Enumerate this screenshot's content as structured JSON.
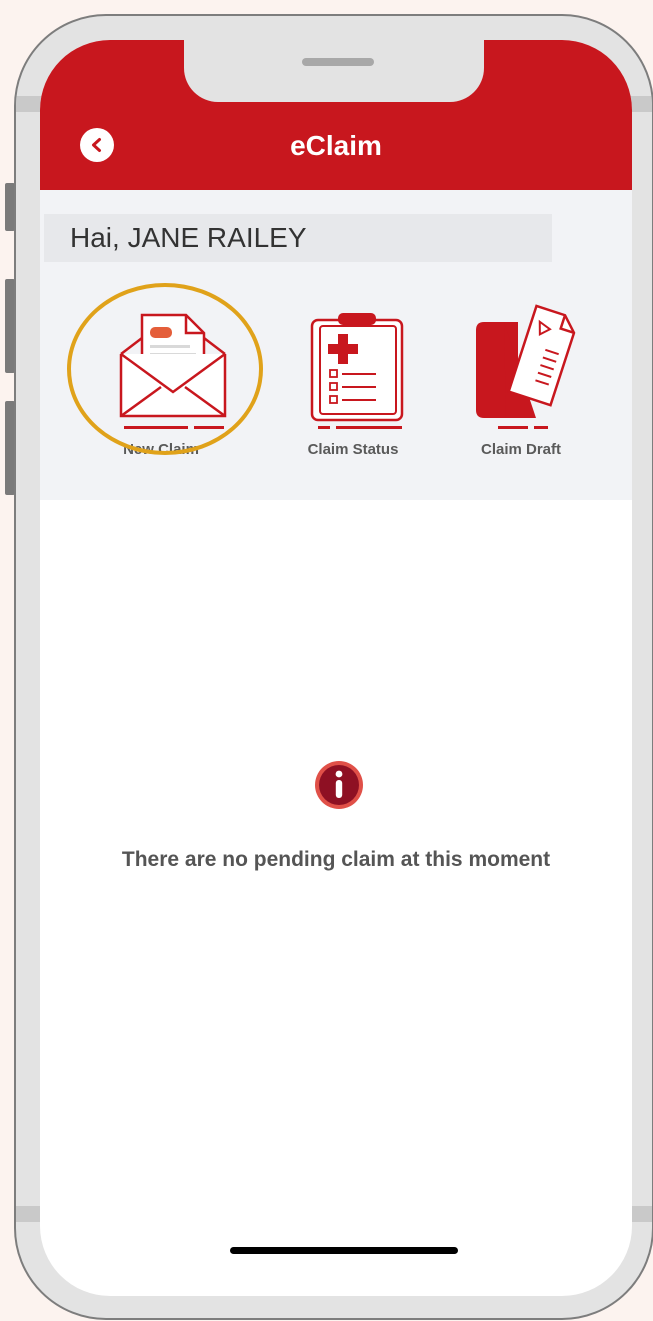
{
  "header": {
    "title": "eClaim",
    "back_icon": "chevron-left-icon",
    "color": "#c8171e"
  },
  "greeting": {
    "text": "Hai, JANE RAILEY"
  },
  "menu": [
    {
      "label": "New Claim",
      "icon": "envelope-document-icon",
      "highlighted": true
    },
    {
      "label": "Claim Status",
      "icon": "clipboard-medical-icon",
      "highlighted": false
    },
    {
      "label": "Claim Draft",
      "icon": "draft-documents-icon",
      "highlighted": false
    }
  ],
  "empty_state": {
    "icon": "info-icon",
    "message": "There are no pending claim at this moment"
  },
  "colors": {
    "accent": "#c8171e",
    "highlight": "#e0a21a",
    "background": "#fcf3ef"
  }
}
